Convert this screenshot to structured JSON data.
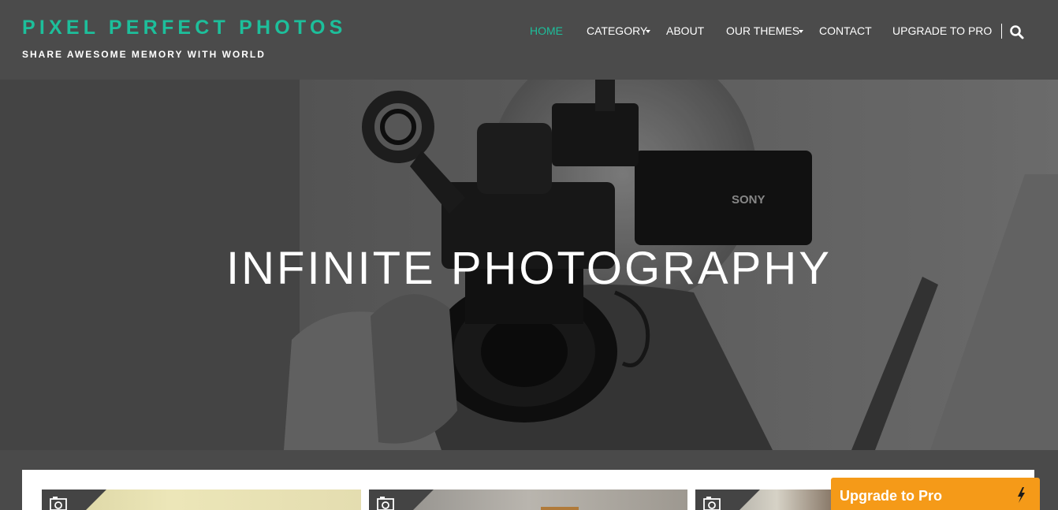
{
  "site": {
    "title": "PIXEL PERFECT PHOTOS",
    "tagline": "SHARE AWESOME MEMORY WITH WORLD"
  },
  "nav": {
    "items": [
      {
        "label": "HOME",
        "active": true,
        "has_dropdown": false
      },
      {
        "label": "CATEGORY",
        "active": false,
        "has_dropdown": true
      },
      {
        "label": "ABOUT",
        "active": false,
        "has_dropdown": false
      },
      {
        "label": "OUR THEMES",
        "active": false,
        "has_dropdown": true
      },
      {
        "label": "CONTACT",
        "active": false,
        "has_dropdown": false
      },
      {
        "label": "UPGRADE TO PRO",
        "active": false,
        "has_dropdown": false
      }
    ],
    "search_icon": "search-icon"
  },
  "hero": {
    "title": "INFINITE PHOTOGRAPHY",
    "camera_brand": "SONY"
  },
  "posts": [
    {
      "icon": "camera-icon"
    },
    {
      "icon": "camera-icon"
    },
    {
      "icon": "camera-icon"
    }
  ],
  "upgrade_widget": {
    "label": "Upgrade to Pro",
    "icon": "bolt-icon"
  },
  "colors": {
    "accent": "#1dbf9b",
    "header_bg": "#4b4b4b",
    "upgrade_orange": "#f59a18"
  }
}
